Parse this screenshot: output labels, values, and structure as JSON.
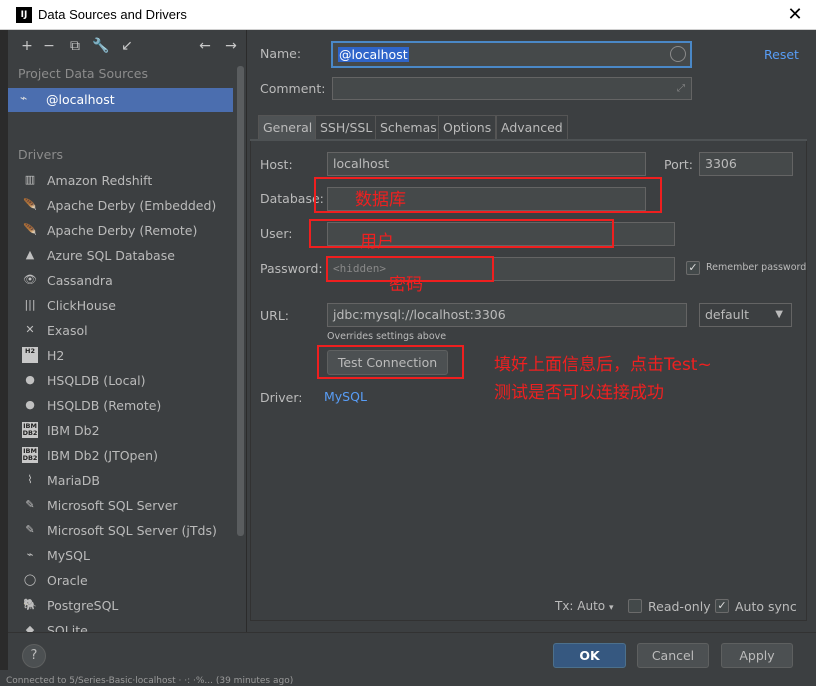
{
  "window": {
    "title": "Data Sources and Drivers",
    "app_icon": "IJ",
    "close_glyph": "✕"
  },
  "left": {
    "toolbar": [
      {
        "icon": "add-icon",
        "glyph": "+",
        "dim": false
      },
      {
        "icon": "remove-icon",
        "glyph": "−",
        "dim": false
      },
      {
        "icon": "duplicate-icon",
        "glyph": "⧉",
        "dim": false
      },
      {
        "icon": "wrench-icon",
        "glyph": "🔧",
        "dim": false
      },
      {
        "icon": "jump-to-source-icon",
        "glyph": "↙",
        "dim": false
      },
      {
        "icon": "back-icon",
        "glyph": "←",
        "dim": true
      },
      {
        "icon": "forward-icon",
        "glyph": "→",
        "dim": true
      }
    ],
    "project_section": "Project Data Sources",
    "selected_source": "@localhost",
    "drivers_section": "Drivers",
    "drivers": [
      {
        "label": "Amazon Redshift",
        "icon": "redshift-icon",
        "glyph": "▥",
        "badge": false
      },
      {
        "label": "Apache Derby (Embedded)",
        "icon": "derby-icon",
        "glyph": "🪶",
        "badge": false
      },
      {
        "label": "Apache Derby (Remote)",
        "icon": "derby-icon",
        "glyph": "🪶",
        "badge": false
      },
      {
        "label": "Azure SQL Database",
        "icon": "azure-icon",
        "glyph": "▲",
        "badge": false
      },
      {
        "label": "Cassandra",
        "icon": "cassandra-icon",
        "glyph": "👁",
        "badge": false
      },
      {
        "label": "ClickHouse",
        "icon": "clickhouse-icon",
        "glyph": "|||",
        "badge": false
      },
      {
        "label": "Exasol",
        "icon": "exasol-icon",
        "glyph": "✕",
        "badge": false
      },
      {
        "label": "H2",
        "icon": "h2-icon",
        "glyph": "H2",
        "badge": true
      },
      {
        "label": "HSQLDB (Local)",
        "icon": "hsqldb-icon",
        "glyph": "●",
        "badge": false
      },
      {
        "label": "HSQLDB (Remote)",
        "icon": "hsqldb-icon",
        "glyph": "●",
        "badge": false
      },
      {
        "label": "IBM Db2",
        "icon": "ibm-db2-icon",
        "glyph": "IBM DB2",
        "badge": true
      },
      {
        "label": "IBM Db2 (JTOpen)",
        "icon": "ibm-db2-icon",
        "glyph": "IBM DB2",
        "badge": true
      },
      {
        "label": "MariaDB",
        "icon": "mariadb-icon",
        "glyph": "⌇",
        "badge": false
      },
      {
        "label": "Microsoft SQL Server",
        "icon": "mssql-icon",
        "glyph": "✎",
        "badge": false
      },
      {
        "label": "Microsoft SQL Server (jTds)",
        "icon": "mssql-icon",
        "glyph": "✎",
        "badge": false
      },
      {
        "label": "MySQL",
        "icon": "mysql-icon",
        "glyph": "⌁",
        "badge": false
      },
      {
        "label": "Oracle",
        "icon": "oracle-icon",
        "glyph": "◯",
        "badge": false
      },
      {
        "label": "PostgreSQL",
        "icon": "postgresql-icon",
        "glyph": "🐘",
        "badge": false
      },
      {
        "label": "SQLite",
        "icon": "sqlite-icon",
        "glyph": "◆",
        "badge": false
      }
    ]
  },
  "form": {
    "name_label": "Name:",
    "name_value": "@localhost",
    "comment_label": "Comment:",
    "reset_label": "Reset",
    "tabs": [
      "General",
      "SSH/SSL",
      "Schemas",
      "Options",
      "Advanced"
    ],
    "host_label": "Host:",
    "host_value": "localhost",
    "port_label": "Port:",
    "port_value": "3306",
    "database_label": "Database:",
    "user_label": "User:",
    "password_label": "Password:",
    "password_placeholder": "<hidden>",
    "remember_password": "Remember password",
    "url_label": "URL:",
    "url_value": "jdbc:mysql://localhost:3306",
    "url_mode": "default",
    "url_hint": "Overrides settings above",
    "test_connection": "Test Connection",
    "driver_label": "Driver:",
    "driver_value": "MySQL",
    "tx_label": "Tx: Auto",
    "read_only": "Read-only",
    "auto_sync": "Auto sync"
  },
  "annotations": {
    "database": "数据库",
    "user": "用户",
    "password": "密码",
    "instruction_line1": "填好上面信息后，点击Test~",
    "instruction_line2": "测试是否可以连接成功"
  },
  "buttons": {
    "ok": "OK",
    "cancel": "Cancel",
    "apply": "Apply",
    "help": "?"
  },
  "status_bar": "Connected to 5/Series-Basic·localhost · ·: ·%... (39 minutes ago)"
}
